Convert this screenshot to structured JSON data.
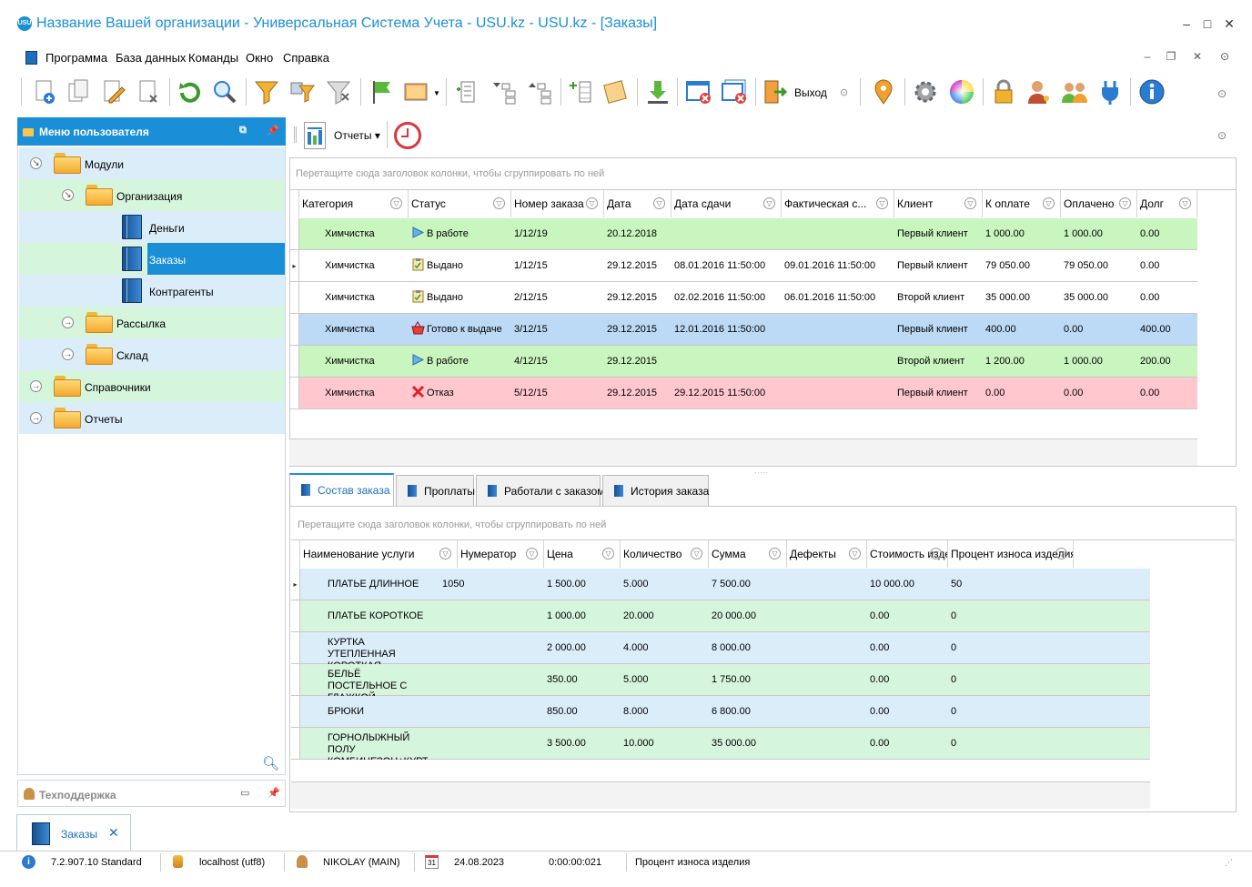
{
  "window": {
    "title": "Название Вашей организации - Универсальная Система Учета - USU.kz - USU.kz - [Заказы]",
    "logo_text": "USU"
  },
  "menu": [
    "Программа",
    "База данных",
    "Команды",
    "Окно",
    "Справка"
  ],
  "toolbar": {
    "exit_label": "Выход",
    "icons": [
      "new-icon",
      "copy-icon",
      "edit-icon",
      "delete-icon",
      "refresh-icon",
      "search-icon",
      "filter-icon",
      "filter-settings-icon",
      "clear-filter-icon",
      "flag-icon",
      "image-icon",
      "expand-tree-icon",
      "group-down-icon",
      "group-up-icon",
      "add-column-icon",
      "notes-icon",
      "download-icon",
      "close-window-icon",
      "close-all-icon",
      "exit-icon",
      "info-circle-icon",
      "location-pin-icon",
      "gear-icon",
      "color-wheel-icon",
      "lock-icon",
      "user-key-icon",
      "users-icon",
      "plugin-icon",
      "info-icon"
    ]
  },
  "left_panel": {
    "title": "Меню пользователя",
    "tree": [
      {
        "label": "Модули",
        "type": "folder",
        "level": 0,
        "expanded": true
      },
      {
        "label": "Организация",
        "type": "folder",
        "level": 1,
        "expanded": true
      },
      {
        "label": "Деньги",
        "type": "book",
        "level": 2
      },
      {
        "label": "Заказы",
        "type": "book",
        "level": 2,
        "selected": true
      },
      {
        "label": "Контрагенты",
        "type": "book",
        "level": 2
      },
      {
        "label": "Рассылка",
        "type": "folder",
        "level": 1,
        "expanded": false
      },
      {
        "label": "Склад",
        "type": "folder",
        "level": 1,
        "expanded": false
      },
      {
        "label": "Справочники",
        "type": "folder",
        "level": 0,
        "expanded": false
      },
      {
        "label": "Отчеты",
        "type": "folder",
        "level": 0,
        "expanded": false
      }
    ],
    "support_title": "Техподдержка"
  },
  "reports_toolbar": {
    "reports_label": "Отчеты"
  },
  "orders": {
    "group_hint": "Перетащите сюда заголовок колонки, чтобы сгруппировать по ней",
    "columns": [
      "Категория",
      "Статус",
      "Номер заказа",
      "Дата",
      "Дата сдачи",
      "Фактическая с...",
      "Клиент",
      "К оплате",
      "Оплачено",
      "Долг"
    ],
    "rows": [
      {
        "color": "g",
        "status_icon": "play",
        "cells": [
          "Химчистка",
          "В работе",
          "1/12/19",
          "20.12.2018",
          "",
          "",
          "Первый клиент",
          "1 000.00",
          "1 000.00",
          "0.00"
        ]
      },
      {
        "color": "w",
        "status_icon": "clipboard",
        "current": true,
        "cells": [
          "Химчистка",
          "Выдано",
          "1/12/15",
          "29.12.2015",
          "08.01.2016 11:50:00",
          "09.01.2016 11:50:00",
          "Первый клиент",
          "79 050.00",
          "79 050.00",
          "0.00"
        ]
      },
      {
        "color": "w",
        "status_icon": "clipboard",
        "cells": [
          "Химчистка",
          "Выдано",
          "2/12/15",
          "29.12.2015",
          "02.02.2016 11:50:00",
          "06.01.2016 11:50:00",
          "Второй клиент",
          "35 000.00",
          "35 000.00",
          "0.00"
        ]
      },
      {
        "color": "b",
        "status_icon": "basket",
        "cells": [
          "Химчистка",
          "Готово к выдаче",
          "3/12/15",
          "29.12.2015",
          "12.01.2016 11:50:00",
          "",
          "Первый клиент",
          "400.00",
          "0.00",
          "400.00"
        ]
      },
      {
        "color": "g",
        "status_icon": "play",
        "cells": [
          "Химчистка",
          "В работе",
          "4/12/15",
          "29.12.2015",
          "",
          "",
          "Второй клиент",
          "1 200.00",
          "1 000.00",
          "200.00"
        ]
      },
      {
        "color": "r",
        "status_icon": "cross",
        "cells": [
          "Химчистка",
          "Отказ",
          "5/12/15",
          "29.12.2015",
          "29.12.2015 11:50:00",
          "",
          "Первый клиент",
          "0.00",
          "0.00",
          "0.00"
        ]
      }
    ]
  },
  "tabs": [
    "Состав заказа",
    "Проплаты",
    "Работали с заказом",
    "История заказа"
  ],
  "items": {
    "group_hint": "Перетащите сюда заголовок колонки, чтобы сгруппировать по ней",
    "columns": [
      "Наименование услуги",
      "Нумератор",
      "Цена",
      "Количество",
      "Сумма",
      "Дефекты",
      "Стоимость изделия",
      "Процент износа изделия"
    ],
    "rows": [
      {
        "color": "lb",
        "current": true,
        "cells": [
          "ПЛАТЬЕ  ДЛИННОЕ",
          "1050",
          "1 500.00",
          "5.000",
          "7 500.00",
          "",
          "10 000.00",
          "50"
        ]
      },
      {
        "color": "lg",
        "cells": [
          "ПЛАТЬЕ КОРОТКОЕ",
          "",
          "1 000.00",
          "20.000",
          "20 000.00",
          "",
          "0.00",
          "0"
        ]
      },
      {
        "color": "lb",
        "cells": [
          "КУРТКА УТЕПЛЕННАЯ КОРОТКАЯ",
          "",
          "2 000.00",
          "4.000",
          "8 000.00",
          "",
          "0.00",
          "0"
        ]
      },
      {
        "color": "lg",
        "cells": [
          "БЕЛЬЁ ПОСТЕЛЬНОЕ С ГЛАЖКОЙ",
          "",
          "350.00",
          "5.000",
          "1 750.00",
          "",
          "0.00",
          "0"
        ]
      },
      {
        "color": "lb",
        "cells": [
          "БРЮКИ",
          "",
          "850.00",
          "8.000",
          "6 800.00",
          "",
          "0.00",
          "0"
        ]
      },
      {
        "color": "lg",
        "cells": [
          "ГОРНОЛЫЖНЫЙ  ПОЛУ КОМБИНЕЗОН+КУРТКА",
          "",
          "3 500.00",
          "10.000",
          "35 000.00",
          "",
          "0.00",
          "0"
        ]
      }
    ]
  },
  "bottom_tab": {
    "label": "Заказы"
  },
  "status": {
    "version": "7.2.907.10 Standard",
    "db": "localhost (utf8)",
    "user": "NIKOLAY (MAIN)",
    "calendar_day": "31",
    "date": "24.08.2023",
    "timer": "0:00:00:021",
    "hint": "Процент износа изделия"
  }
}
